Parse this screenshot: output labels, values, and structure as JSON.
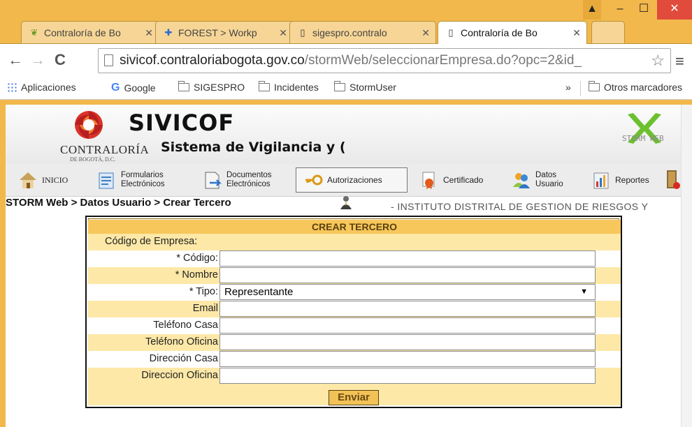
{
  "browser": {
    "tabs": [
      {
        "title": "Contraloría de Bo",
        "active": false
      },
      {
        "title": "FOREST > Workp",
        "active": false
      },
      {
        "title": "sigespro.contralo",
        "active": false
      },
      {
        "title": "Contraloría de Bo",
        "active": true
      }
    ],
    "url_host": "sivicof.contraloriabogota.gov.co",
    "url_path": "/stormWeb/seleccionarEmpresa.do?opc=2&id_",
    "bookmarks": [
      "Aplicaciones",
      "Google",
      "SIGESPRO",
      "Incidentes",
      "StormUser"
    ],
    "bookmarks_overflow": "»",
    "other_bookmarks": "Otros marcadores",
    "chrome_color": "#f2b84c"
  },
  "header": {
    "logo_line1": "CONTRALORÍA",
    "logo_line2": "DE BOGOTÁ, D.C.",
    "app_title": "SIVICOF",
    "app_subtitle": "Sistema de Vigilancia y (",
    "storm_logo": "STORM WEB"
  },
  "menu": {
    "items": [
      {
        "label": "INICIO",
        "icon": "home-icon"
      },
      {
        "label1": "Formularios",
        "label2": "Electrónicos",
        "icon": "forms-icon"
      },
      {
        "label1": "Documentos",
        "label2": "Electrónicos",
        "icon": "documents-icon"
      },
      {
        "label": "Autorizaciones",
        "icon": "key-icon"
      },
      {
        "label": "Certificado",
        "icon": "certificate-icon"
      },
      {
        "label1": "Datos",
        "label2": "Usuario",
        "icon": "users-icon"
      },
      {
        "label": "Reportes",
        "icon": "chart-icon"
      }
    ]
  },
  "breadcrumb": "STORM Web > Datos Usuario > Crear Tercero",
  "company": "- INSTITUTO DISTRITAL DE GESTION DE RIESGOS Y",
  "form": {
    "title": "CREAR TERCERO",
    "company_code_label": "Código de Empresa:",
    "fields": [
      {
        "label": "* Código:",
        "value": ""
      },
      {
        "label": "* Nombre",
        "value": ""
      },
      {
        "label": "* Tipo:",
        "value": "Representante"
      },
      {
        "label": "Email",
        "value": ""
      },
      {
        "label": "Teléfono Casa",
        "value": ""
      },
      {
        "label": "Teléfono Oficina",
        "value": ""
      },
      {
        "label": "Dirección Casa",
        "value": ""
      },
      {
        "label": "Direccion Oficina",
        "value": ""
      }
    ],
    "submit": "Enviar",
    "highlight_color": "#fde8a7",
    "title_color": "#f7c75b"
  }
}
